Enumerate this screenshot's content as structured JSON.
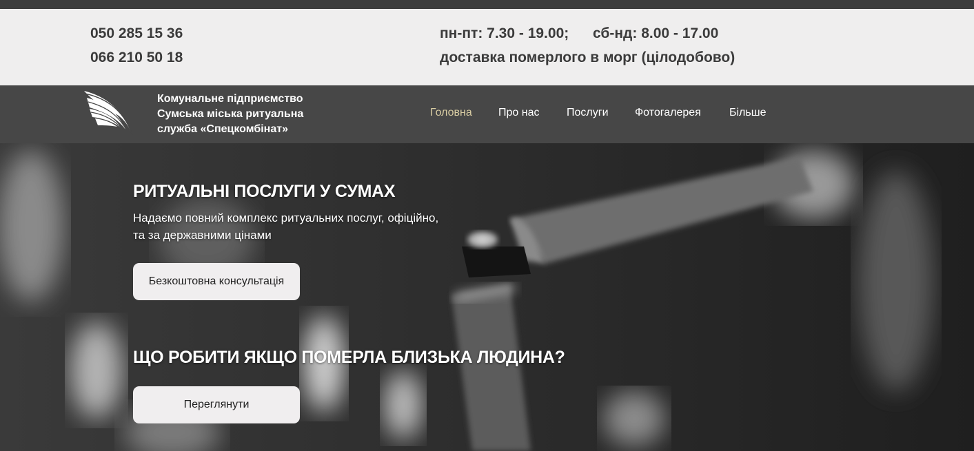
{
  "contacts": {
    "phone_1": "050 285 15 36",
    "phone_2": "066 210 50 18",
    "hours_weekdays": "пн-пт: 7.30 - 19.00;",
    "hours_weekend": "сб-нд: 8.00 - 17.00",
    "delivery_note": "доставка померлого в морг (цілодобово)"
  },
  "header": {
    "logo_icon": "wing-icon",
    "org_name_lines": [
      "Комунальне підприємство",
      "Сумська міська ритуальна",
      "служба «Спецкомбінат»"
    ],
    "nav": [
      {
        "label": "Головна",
        "active": true
      },
      {
        "label": "Про нас",
        "active": false
      },
      {
        "label": "Послуги",
        "active": false
      },
      {
        "label": "Фотогалерея",
        "active": false
      },
      {
        "label": "Більше",
        "active": false
      }
    ]
  },
  "hero": {
    "title": "РИТУАЛЬНІ ПОСЛУГИ У СУМАХ",
    "subtitle_lines": [
      "Надаємо повний комплекс ритуальних послуг, офіційно,",
      "та за державними цінами"
    ],
    "consult_button": "Безкоштовна консультація",
    "question_title": "ЩО РОБИТИ ЯКЩО ПОМЕРЛА БЛИЗЬКА ЛЮДИНА?",
    "view_button": "Переглянути"
  },
  "colors": {
    "contact_bg": "#efeeee",
    "header_bg": "#474747",
    "nav_active": "#d9cda3",
    "button_bg": "#f0eeef"
  }
}
